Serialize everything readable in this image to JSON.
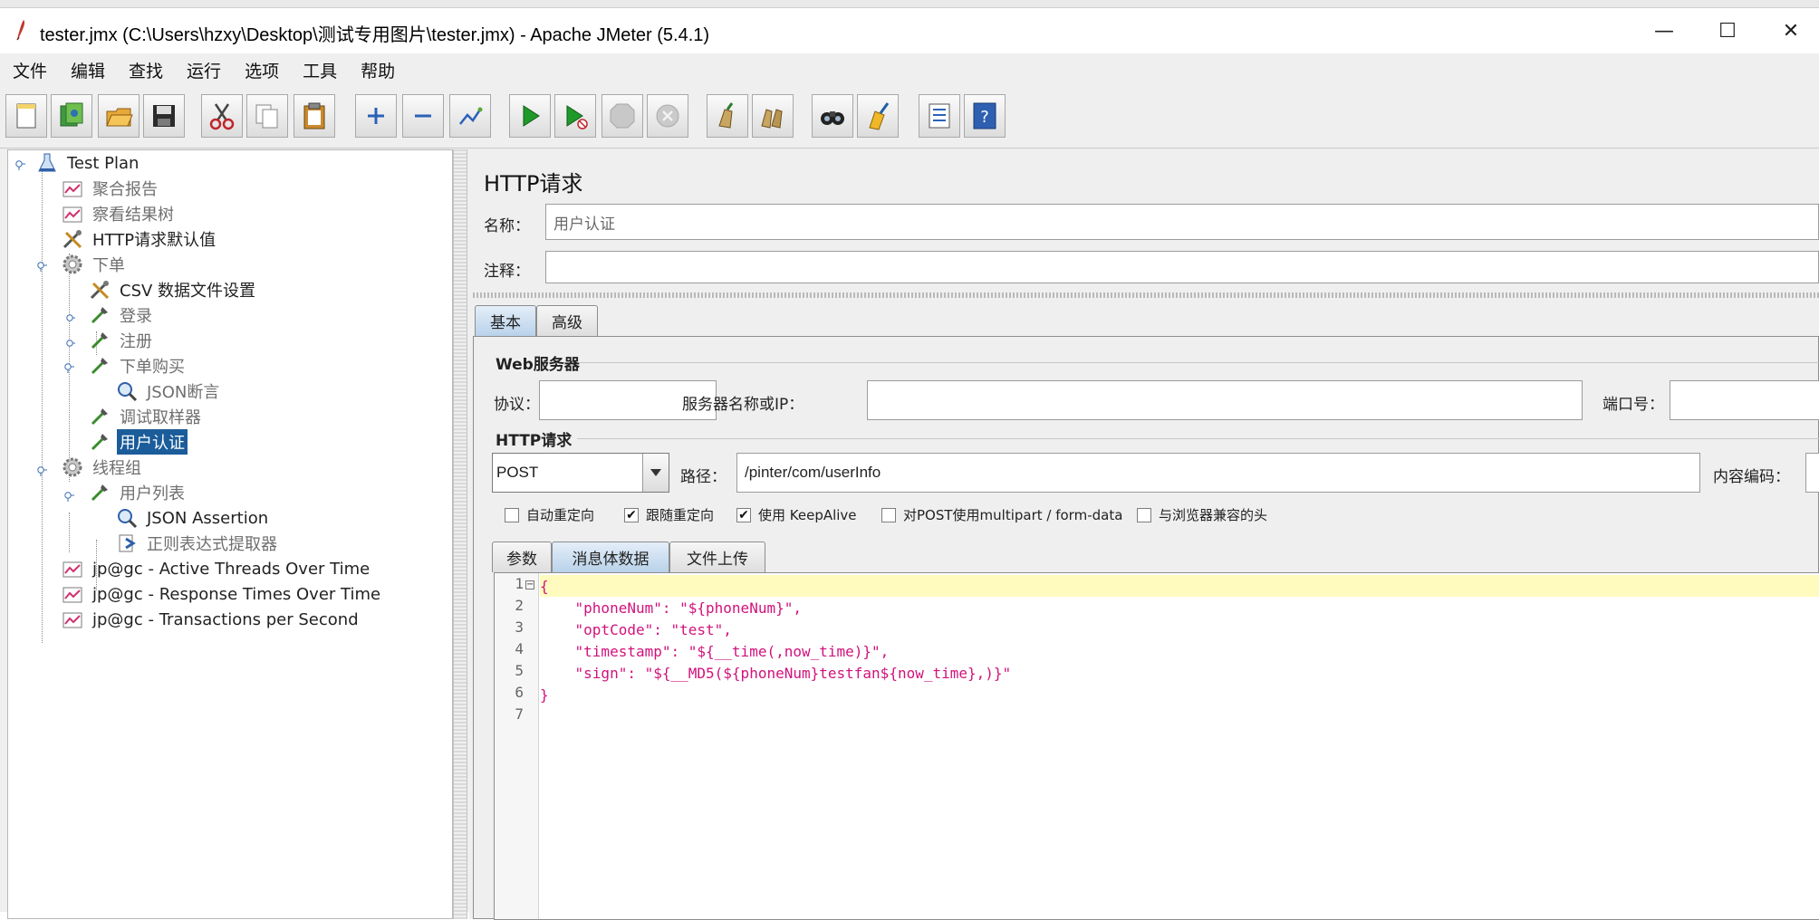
{
  "window": {
    "title": "tester.jmx (C:\\Users\\hzxy\\Desktop\\测试专用图片\\tester.jmx) - Apache JMeter (5.4.1)",
    "controls": {
      "minimize": "—",
      "maximize": "☐",
      "close": "✕"
    }
  },
  "menu": [
    "文件",
    "编辑",
    "查找",
    "运行",
    "选项",
    "工具",
    "帮助"
  ],
  "toolbar": [
    {
      "name": "new-icon"
    },
    {
      "name": "templates-icon"
    },
    {
      "name": "open-icon"
    },
    {
      "name": "save-icon"
    },
    {
      "name": "cut-icon"
    },
    {
      "name": "copy-icon"
    },
    {
      "name": "paste-icon"
    },
    {
      "name": "expand-icon"
    },
    {
      "name": "collapse-icon"
    },
    {
      "name": "toggle-icon"
    },
    {
      "name": "start-icon"
    },
    {
      "name": "start-no-pause-icon"
    },
    {
      "name": "stop-icon"
    },
    {
      "name": "shutdown-icon"
    },
    {
      "name": "clear-icon"
    },
    {
      "name": "clear-all-icon"
    },
    {
      "name": "search-icon"
    },
    {
      "name": "reset-search-icon"
    },
    {
      "name": "function-helper-icon"
    },
    {
      "name": "help-icon"
    }
  ],
  "tree": {
    "items": [
      {
        "label": "Test Plan"
      },
      {
        "label": "聚合报告"
      },
      {
        "label": "察看结果树"
      },
      {
        "label": "HTTP请求默认值"
      },
      {
        "label": "下单"
      },
      {
        "label": "CSV 数据文件设置"
      },
      {
        "label": "登录"
      },
      {
        "label": "注册"
      },
      {
        "label": "下单购买"
      },
      {
        "label": "JSON断言"
      },
      {
        "label": "调试取样器"
      },
      {
        "label": "用户认证"
      },
      {
        "label": "线程组"
      },
      {
        "label": "用户列表"
      },
      {
        "label": "JSON Assertion"
      },
      {
        "label": "正则表达式提取器"
      },
      {
        "label": "jp@gc - Active Threads Over Time"
      },
      {
        "label": "jp@gc - Response Times Over Time"
      },
      {
        "label": "jp@gc - Transactions per Second"
      }
    ]
  },
  "panel": {
    "title": "HTTP请求",
    "name_label": "名称：",
    "name_value": "用户认证",
    "comment_label": "注释：",
    "comment_value": "",
    "tabs": [
      "基本",
      "高级"
    ],
    "web_server": {
      "group_title": "Web服务器",
      "protocol_label": "协议：",
      "protocol_value": "",
      "server_label": "服务器名称或IP：",
      "server_value": "",
      "port_label": "端口号：",
      "port_value": ""
    },
    "http_request": {
      "group_title": "HTTP请求",
      "method": "POST",
      "path_label": "路径：",
      "path_value": "/pinter/com/userInfo",
      "encoding_label": "内容编码：",
      "encoding_value": ""
    },
    "options": [
      {
        "label": "自动重定向",
        "checked": false,
        "mark": ""
      },
      {
        "label": "跟随重定向",
        "checked": true,
        "mark": "✔"
      },
      {
        "label": "使用 KeepAlive",
        "checked": true,
        "mark": "✔"
      },
      {
        "label": "对POST使用multipart / form-data",
        "checked": false,
        "mark": ""
      },
      {
        "label": "与浏览器兼容的头",
        "checked": false,
        "mark": ""
      }
    ],
    "body_tabs": [
      "参数",
      "消息体数据",
      "文件上传"
    ],
    "editor": {
      "line_numbers": [
        "1",
        "2",
        "3",
        "4",
        "5",
        "6",
        "7"
      ],
      "lines": [
        "{",
        "    \"phoneNum\": \"${phoneNum}\",",
        "    \"optCode\": \"test\",",
        "    \"timestamp\": \"${__time(,now_time)}\",",
        "    \"sign\": \"${__MD5(${phoneNum}testfan${now_time},)}\"",
        "}",
        ""
      ]
    }
  }
}
